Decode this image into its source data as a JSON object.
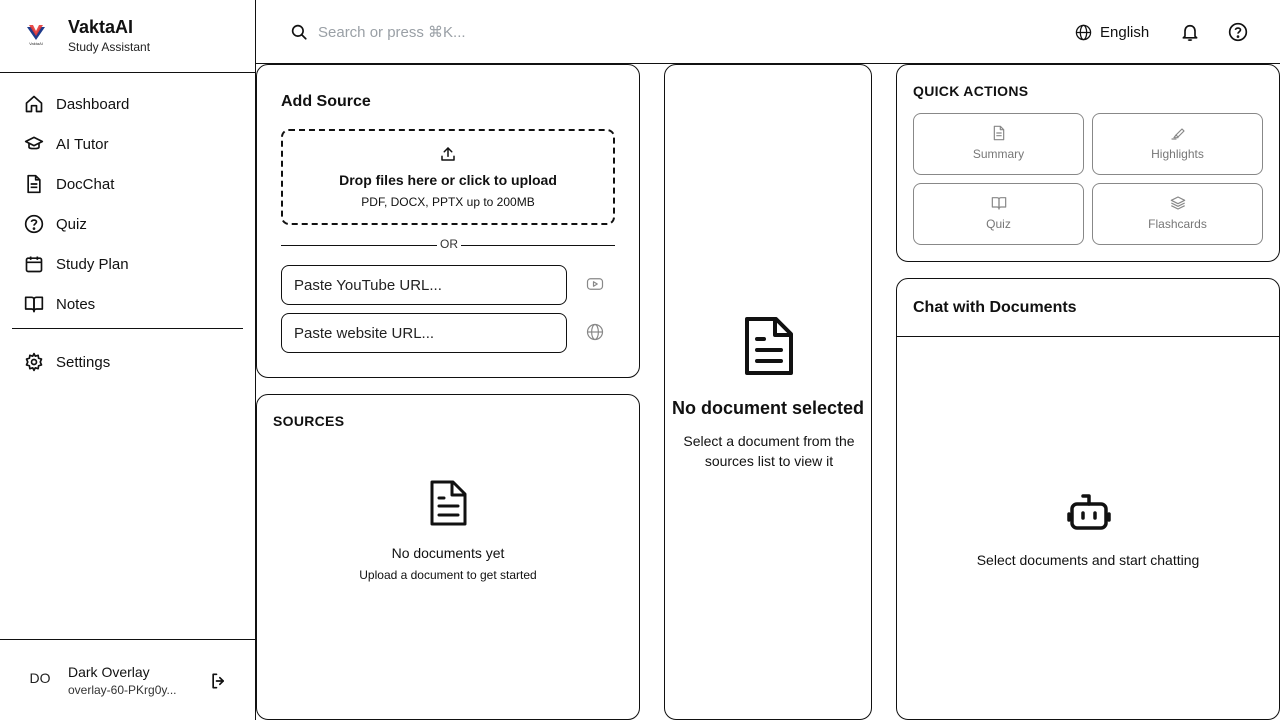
{
  "brand": {
    "name": "VaktaAI",
    "subtitle": "Study Assistant",
    "logo_text": "VaktaAI",
    "colors": {
      "accent_red": "#e53935",
      "accent_blue": "#1e3a8a"
    }
  },
  "sidebar": {
    "items": [
      {
        "label": "Dashboard",
        "icon": "home-icon"
      },
      {
        "label": "AI Tutor",
        "icon": "graduation-cap-icon"
      },
      {
        "label": "DocChat",
        "icon": "file-text-icon"
      },
      {
        "label": "Quiz",
        "icon": "help-circle-icon"
      },
      {
        "label": "Study Plan",
        "icon": "calendar-icon"
      },
      {
        "label": "Notes",
        "icon": "book-open-icon"
      }
    ],
    "settings": {
      "label": "Settings",
      "icon": "gear-icon"
    }
  },
  "user": {
    "initials": "DO",
    "name": "Dark Overlay",
    "id": "overlay-60-PKrg0y..."
  },
  "topbar": {
    "search_placeholder": "Search or press ⌘K...",
    "language": "English"
  },
  "add_source": {
    "title": "Add Source",
    "dropzone_main": "Drop files here or click to upload",
    "dropzone_sub": "PDF, DOCX, PPTX up to 200MB",
    "or_text": "OR",
    "youtube_placeholder": "Paste YouTube URL...",
    "website_placeholder": "Paste website URL..."
  },
  "sources": {
    "title": "SOURCES",
    "empty_title": "No documents yet",
    "empty_sub": "Upload a document to get started"
  },
  "viewer": {
    "empty_title": "No document selected",
    "empty_sub": "Select a document from the sources list to view it"
  },
  "quick_actions": {
    "title": "QUICK ACTIONS",
    "buttons": [
      {
        "label": "Summary",
        "icon": "file-text-icon"
      },
      {
        "label": "Highlights",
        "icon": "highlighter-icon"
      },
      {
        "label": "Quiz",
        "icon": "book-open-icon"
      },
      {
        "label": "Flashcards",
        "icon": "layers-icon"
      }
    ]
  },
  "chat": {
    "title": "Chat with Documents",
    "empty_text": "Select documents and start chatting"
  }
}
